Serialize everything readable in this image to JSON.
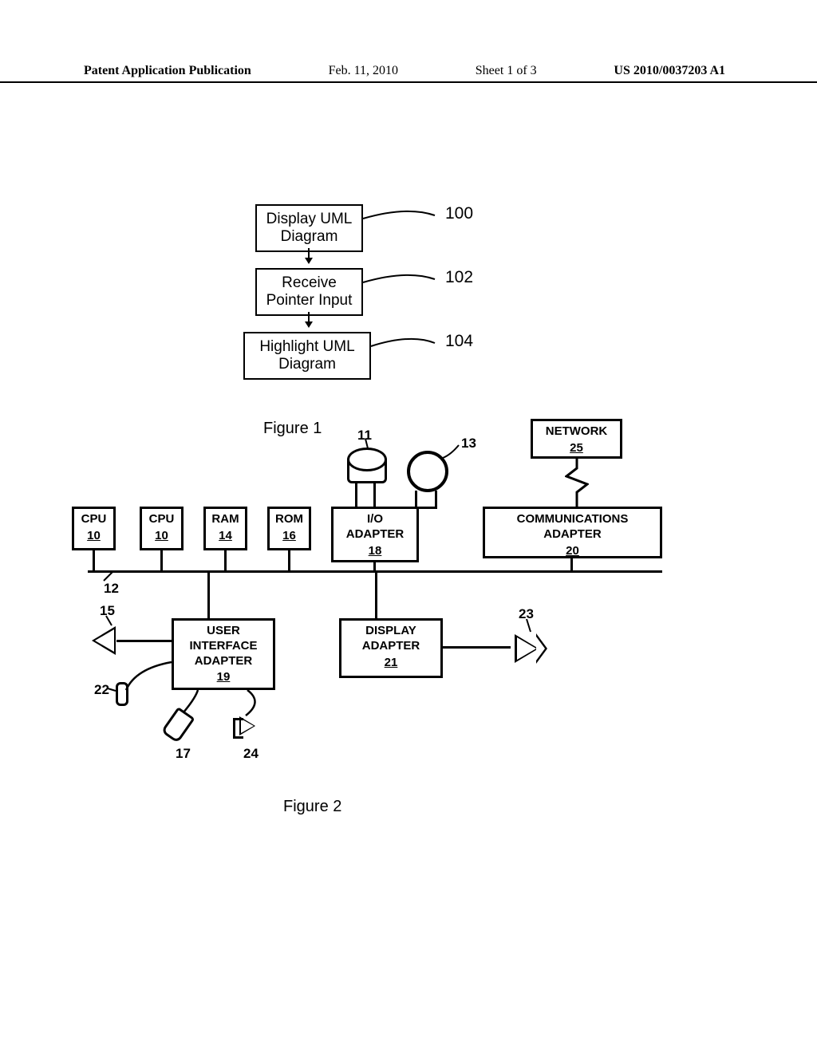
{
  "header": {
    "left": "Patent Application Publication",
    "date": "Feb. 11, 2010",
    "sheet": "Sheet 1 of 3",
    "pubno": "US 2010/0037203 A1"
  },
  "fig1": {
    "caption": "Figure 1",
    "steps": [
      {
        "label": "Display UML\nDiagram",
        "ref": "100"
      },
      {
        "label": "Receive\nPointer Input",
        "ref": "102"
      },
      {
        "label": "Highlight UML\nDiagram",
        "ref": "104"
      }
    ]
  },
  "fig2": {
    "caption": "Figure 2",
    "blocks": {
      "cpu1": {
        "label": "CPU",
        "num": "10"
      },
      "cpu2": {
        "label": "CPU",
        "num": "10"
      },
      "ram": {
        "label": "RAM",
        "num": "14"
      },
      "rom": {
        "label": "ROM",
        "num": "16"
      },
      "io": {
        "label": "I/O\nADAPTER",
        "num": "18"
      },
      "comm": {
        "label": "COMMUNICATIONS\nADAPTER",
        "num": "20"
      },
      "net": {
        "label": "NETWORK",
        "num": "25"
      },
      "ui": {
        "label": "USER\nINTERFACE\nADAPTER",
        "num": "19"
      },
      "disp": {
        "label": "DISPLAY\nADAPTER",
        "num": "21"
      }
    },
    "refs": {
      "r11": "11",
      "r12": "12",
      "r13": "13",
      "r15": "15",
      "r17": "17",
      "r22": "22",
      "r23": "23",
      "r24": "24"
    }
  }
}
